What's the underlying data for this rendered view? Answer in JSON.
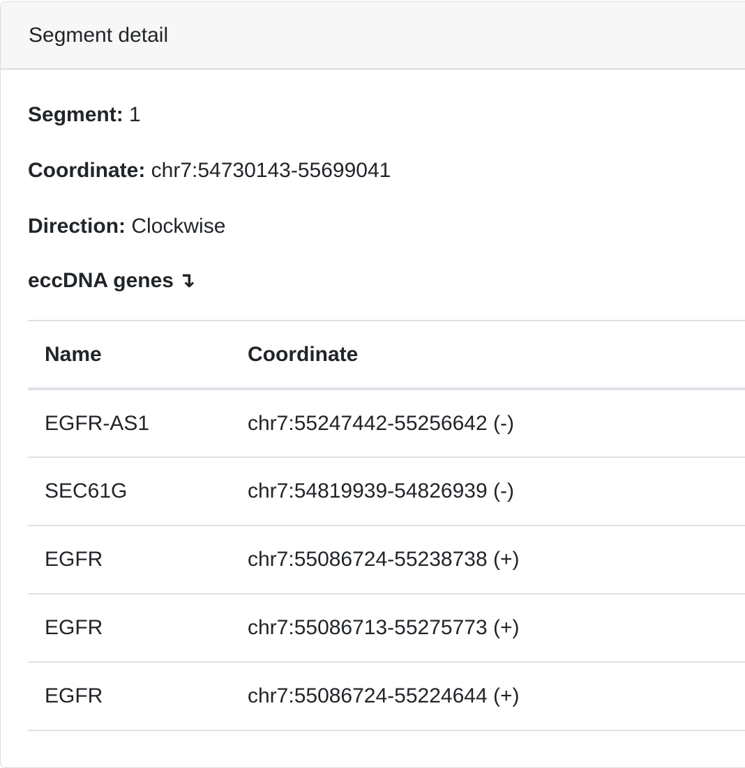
{
  "card": {
    "header_title": "Segment detail"
  },
  "details": {
    "segment_label": "Segment:",
    "segment_value": "1",
    "coordinate_label": "Coordinate:",
    "coordinate_value": "chr7:54730143-55699041",
    "direction_label": "Direction:",
    "direction_value": "Clockwise"
  },
  "genes": {
    "heading": "eccDNA genes",
    "heading_icon": "arrow-down-icon",
    "heading_arrow_glyph": "↴",
    "columns": {
      "name": "Name",
      "coordinate": "Coordinate"
    },
    "rows": [
      {
        "name": "EGFR-AS1",
        "coordinate": "chr7:55247442-55256642 (-)"
      },
      {
        "name": "SEC61G",
        "coordinate": "chr7:54819939-54826939 (-)"
      },
      {
        "name": "EGFR",
        "coordinate": "chr7:55086724-55238738 (+)"
      },
      {
        "name": "EGFR",
        "coordinate": "chr7:55086713-55275773 (+)"
      },
      {
        "name": "EGFR",
        "coordinate": "chr7:55086724-55224644 (+)"
      }
    ]
  }
}
